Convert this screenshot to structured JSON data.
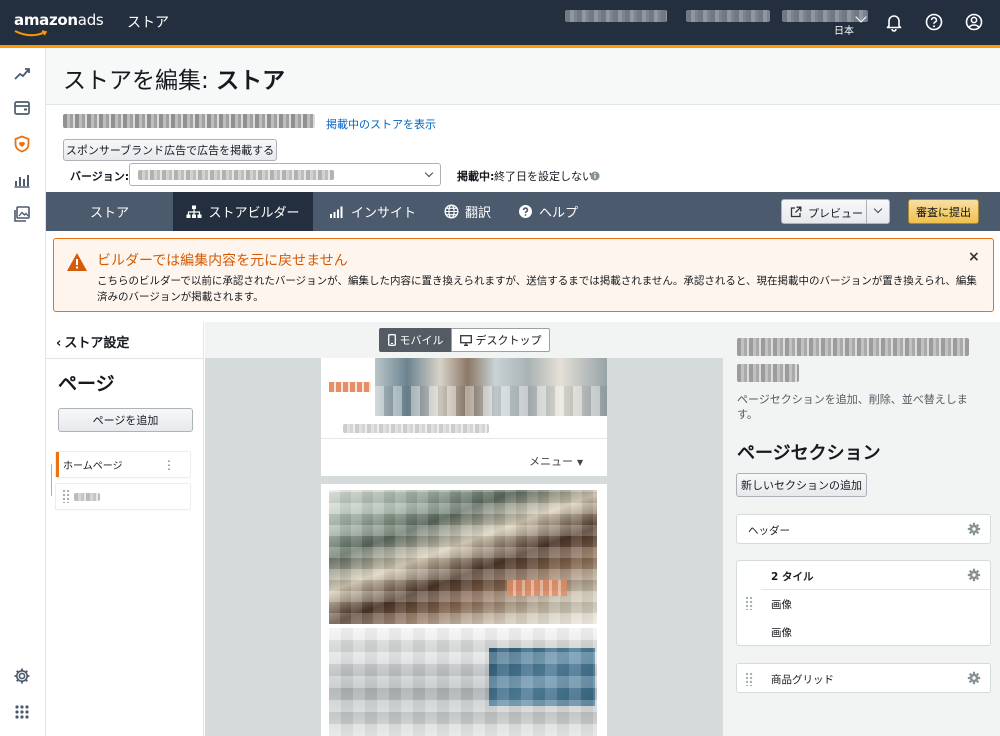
{
  "topbar": {
    "logo_main": "amazon",
    "logo_ads": "ads",
    "app_name": "ストア",
    "country": "日本"
  },
  "page": {
    "title_prefix": "ストアを編集: ",
    "title_bold": "ストア",
    "view_live_link": "掲載中のストアを表示",
    "sb_button": "スポンサーブランド広告で広告を掲載する",
    "version_label": "バージョン:",
    "live_label": "掲載中:",
    "live_value": "終了日を設定しない"
  },
  "nav": {
    "items": [
      {
        "label": "ストア"
      },
      {
        "label": "ストアビルダー"
      },
      {
        "label": "インサイト"
      },
      {
        "label": "翻訳"
      },
      {
        "label": "ヘルプ"
      }
    ],
    "active": "ストアビルダー",
    "preview_button": "プレビュー",
    "submit_button": "審査に提出"
  },
  "alert": {
    "title": "ビルダーでは編集内容を元に戻せません",
    "body": "こちらのビルダーで以前に承認されたバージョンが、編集した内容に置き換えられますが、送信するまでは掲載されません。承認されると、現在掲載中のバージョンが置き換えられ、編集済みのバージョンが掲載されます。",
    "close": "×"
  },
  "left_panel": {
    "back_label": "ストア設定",
    "title": "ページ",
    "add_page_button": "ページを追加",
    "pages": [
      {
        "label": "ホームページ",
        "selected": true
      }
    ],
    "more_icon": "⋮"
  },
  "canvas": {
    "mobile_tab": "モバイル",
    "desktop_tab": "デスクトップ",
    "active_tab": "モバイル",
    "menu_label": "メニュー"
  },
  "right_panel": {
    "description": "ページセクションを追加、削除、並べ替えします。",
    "sections_title": "ページセクション",
    "add_section_button": "新しいセクションの追加",
    "sections": [
      {
        "label": "ヘッダー"
      },
      {
        "label": "2 タイル",
        "children": [
          "画像",
          "画像"
        ]
      },
      {
        "label": "商品グリッド"
      }
    ]
  },
  "colors": {
    "topbar": "#232f3e",
    "accent": "#ff9900",
    "navbar": "#4b5a6c",
    "alert_border": "#ec7211",
    "alert_title": "#d45b07",
    "link": "#0066c0",
    "submit": "#f0c14b"
  }
}
